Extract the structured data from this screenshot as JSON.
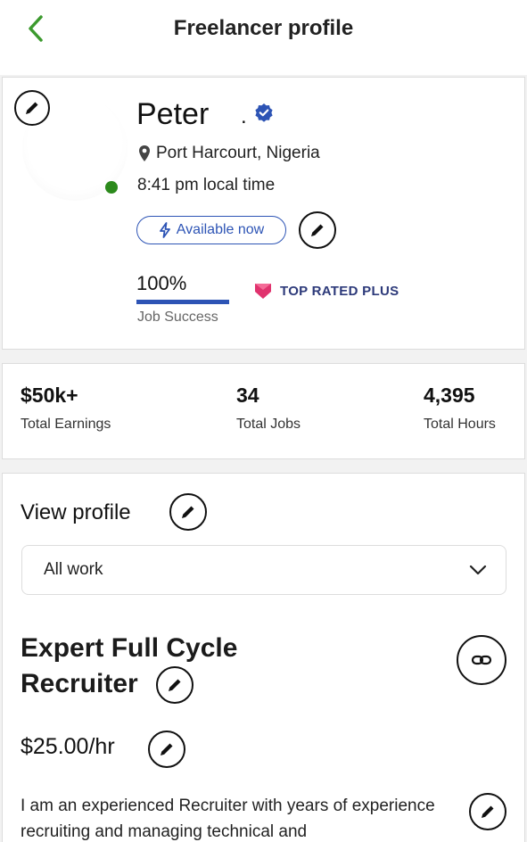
{
  "header": {
    "title": "Freelancer profile"
  },
  "profile": {
    "name": "Peter",
    "name_suffix": ".",
    "location": "Port Harcourt, Nigeria",
    "local_time": "8:41 pm local time",
    "availability": "Available now",
    "job_success_percent": "100%",
    "job_success_fraction": 1.0,
    "job_success_label": "Job Success",
    "badge": "TOP RATED PLUS"
  },
  "stats": [
    {
      "value": "$50k+",
      "label": "Total Earnings"
    },
    {
      "value": "34",
      "label": "Total Jobs"
    },
    {
      "value": "4,395",
      "label": "Total Hours"
    }
  ],
  "work": {
    "view_profile_label": "View profile",
    "dropdown_selected": "All work",
    "title_line1": "Expert Full Cycle",
    "title_line2": "Recruiter",
    "rate": "$25.00/hr",
    "description": "I am an experienced Recruiter with years of experience recruiting and managing technical and"
  },
  "colors": {
    "accent_green": "#3c9a2e",
    "accent_blue": "#2d54b5",
    "badge_pink": "#e0336e",
    "online_green": "#2c8a1c"
  }
}
